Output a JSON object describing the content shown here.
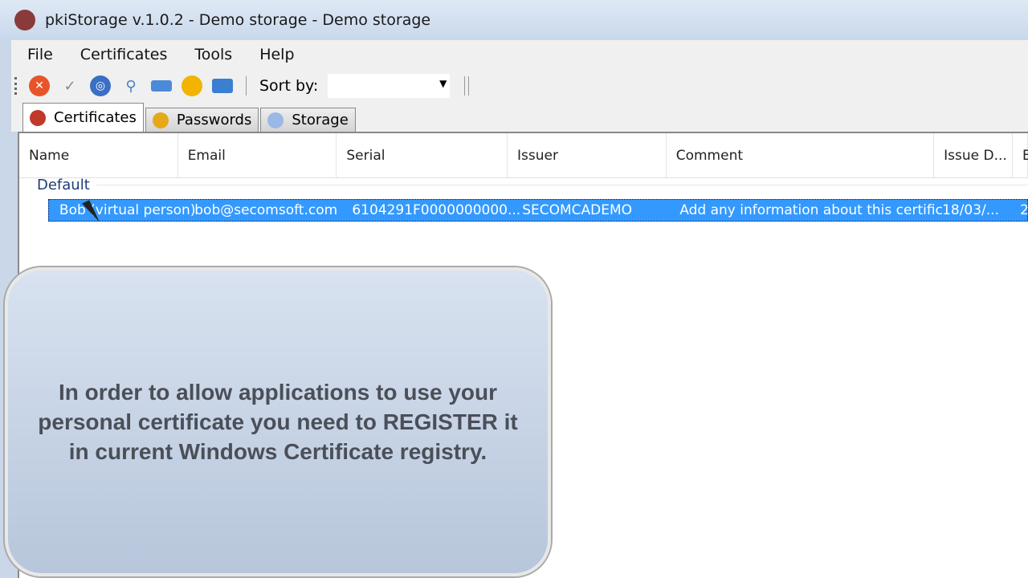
{
  "window": {
    "title": "pkiStorage v.1.0.2 - Demo storage - Demo storage",
    "app_icon_text": "pki"
  },
  "menu": [
    "File",
    "Certificates",
    "Tools",
    "Help"
  ],
  "toolbar": {
    "icons": [
      "delete-icon",
      "verify-icon",
      "globe-icon",
      "search-key-icon",
      "folder-icon",
      "user-icon",
      "register-icon"
    ],
    "sort_label": "Sort by:",
    "sort_value": ""
  },
  "tabs": [
    {
      "label": "Certificates",
      "active": true
    },
    {
      "label": "Passwords",
      "active": false
    },
    {
      "label": "Storage",
      "active": false
    }
  ],
  "table": {
    "columns": [
      "Name",
      "Email",
      "Serial",
      "Issuer",
      "Comment",
      "Issue D...",
      "E"
    ],
    "group": "Default",
    "rows": [
      {
        "name": "Bob (virtual person)",
        "email": "bob@secomsoft.com",
        "serial": "6104291F0000000000...",
        "issuer": "SECOMCADEMO",
        "comment": "Add any information about this certific...",
        "issue_date": "18/03/...",
        "extra": "2"
      }
    ]
  },
  "overlay": {
    "text": "In order to allow applications to use your personal certificate you need to REGISTER it in current Windows Certificate registry."
  },
  "colors": {
    "selection": "#3399ff",
    "overlay": "#c8d4e6"
  }
}
